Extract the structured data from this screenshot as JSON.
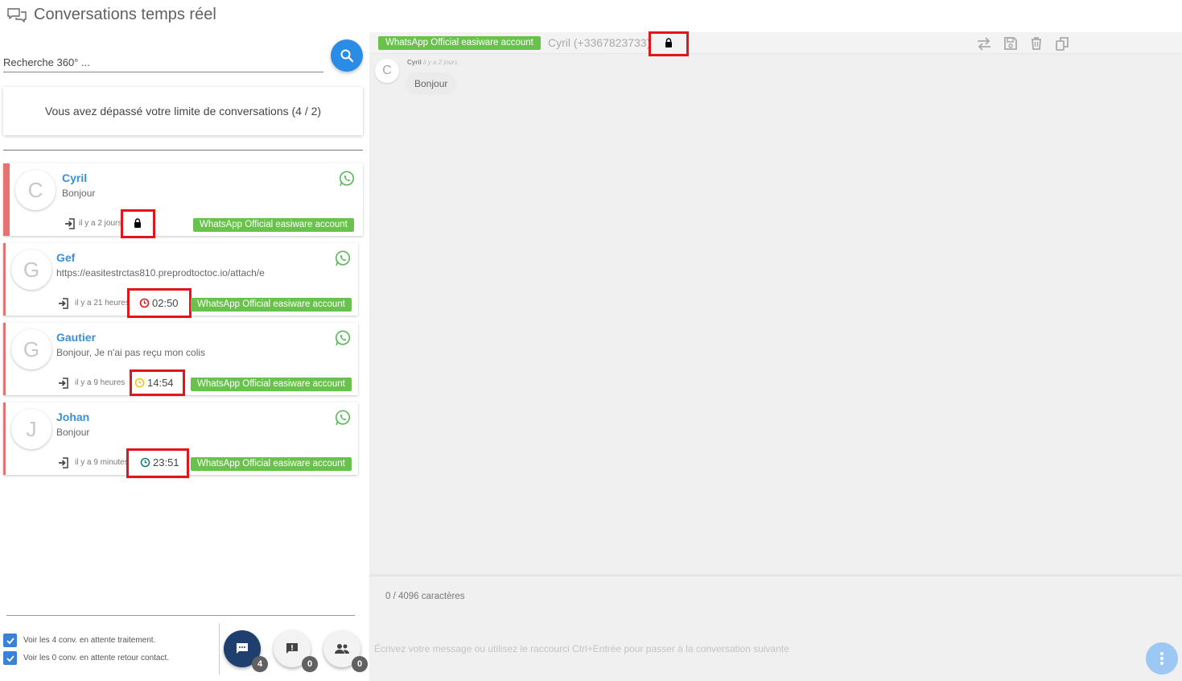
{
  "header": {
    "title": "Conversations temps réel",
    "icon": "chat-bubbles-icon"
  },
  "search": {
    "placeholder": "Recherche 360° ..."
  },
  "limit_message": "Vous avez dépassé votre limite de conversations (4 / 2)",
  "conversations": [
    {
      "initial": "C",
      "name": "Cyril",
      "preview": "Bonjour",
      "time_ago": "il y a 2 jours",
      "status": "lock",
      "timer": "",
      "channel": "WhatsApp Official easiware account"
    },
    {
      "initial": "G",
      "name": "Gef",
      "preview": "https://easitestrctas810.preprodtoctoc.io/attach/e",
      "time_ago": "il y a 21 heures",
      "status": "timer-red",
      "timer": "02:50",
      "channel": "WhatsApp Official easiware account"
    },
    {
      "initial": "G",
      "name": "Gautier",
      "preview": "Bonjour, Je n'ai pas reçu mon colis",
      "time_ago": "il y a 9 heures",
      "status": "timer-yellow",
      "timer": "14:54",
      "channel": "WhatsApp Official easiware account"
    },
    {
      "initial": "J",
      "name": "Johan",
      "preview": "Bonjour",
      "time_ago": "il y a 9 minutes",
      "status": "timer-teal",
      "timer": "23:51",
      "channel": "WhatsApp Official easiware account"
    }
  ],
  "footer": {
    "checkbox1": "Voir les 4 conv. en attente traitement.",
    "checkbox2": "Voir les 0 conv. en attente retour contact.",
    "buttons": [
      {
        "icon": "chat-icon",
        "count": "4"
      },
      {
        "icon": "feedback-icon",
        "count": "0"
      },
      {
        "icon": "people-icon",
        "count": "0"
      }
    ]
  },
  "chat": {
    "channel": "WhatsApp Official easiware account",
    "contact": "Cyril (+3367823733)",
    "messages": [
      {
        "initial": "C",
        "author": "Cyril",
        "time": "il y a 2 jours",
        "text": "Bonjour"
      }
    ],
    "counter": "0 / 4096 caractères",
    "input_placeholder": "Écrivez votre message ou utilisez le raccourci Ctrl+Entrée pour passer à la conversation suivante"
  },
  "colors": {
    "accent": "#2b8ce6",
    "tag_green": "#69c24b",
    "highlight": "#e2151d",
    "name_blue": "#3a8fd6",
    "border_red": "#e57373"
  }
}
